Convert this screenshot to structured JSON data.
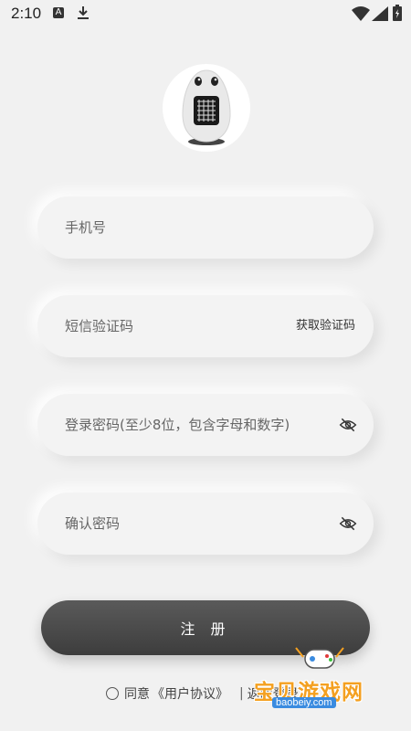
{
  "status_bar": {
    "time": "2:10",
    "a_badge": "A"
  },
  "icons": {
    "download": "download-icon",
    "wifi": "wifi-icon",
    "signal": "signal-icon",
    "battery": "battery-icon",
    "eye": "eye-slash-icon",
    "avatar": "robot-egg-avatar"
  },
  "form": {
    "phone_placeholder": "手机号",
    "sms_placeholder": "短信验证码",
    "get_code_label": "获取验证码",
    "password_placeholder": "登录密码(至少8位，包含字母和数字)",
    "confirm_placeholder": "确认密码"
  },
  "register_label": "注 册",
  "agreement": {
    "agree_text": "同意",
    "link_text": "《用户协议》",
    "divider": "|",
    "back_login": "返回登录"
  },
  "watermark": {
    "title": "宝贝游戏网",
    "url": "baobeiy.com"
  },
  "colors": {
    "background": "#f1f1f1",
    "button": "#4a4a4a",
    "watermark_orange": "#f4a020",
    "watermark_blue": "#3a8be0"
  }
}
